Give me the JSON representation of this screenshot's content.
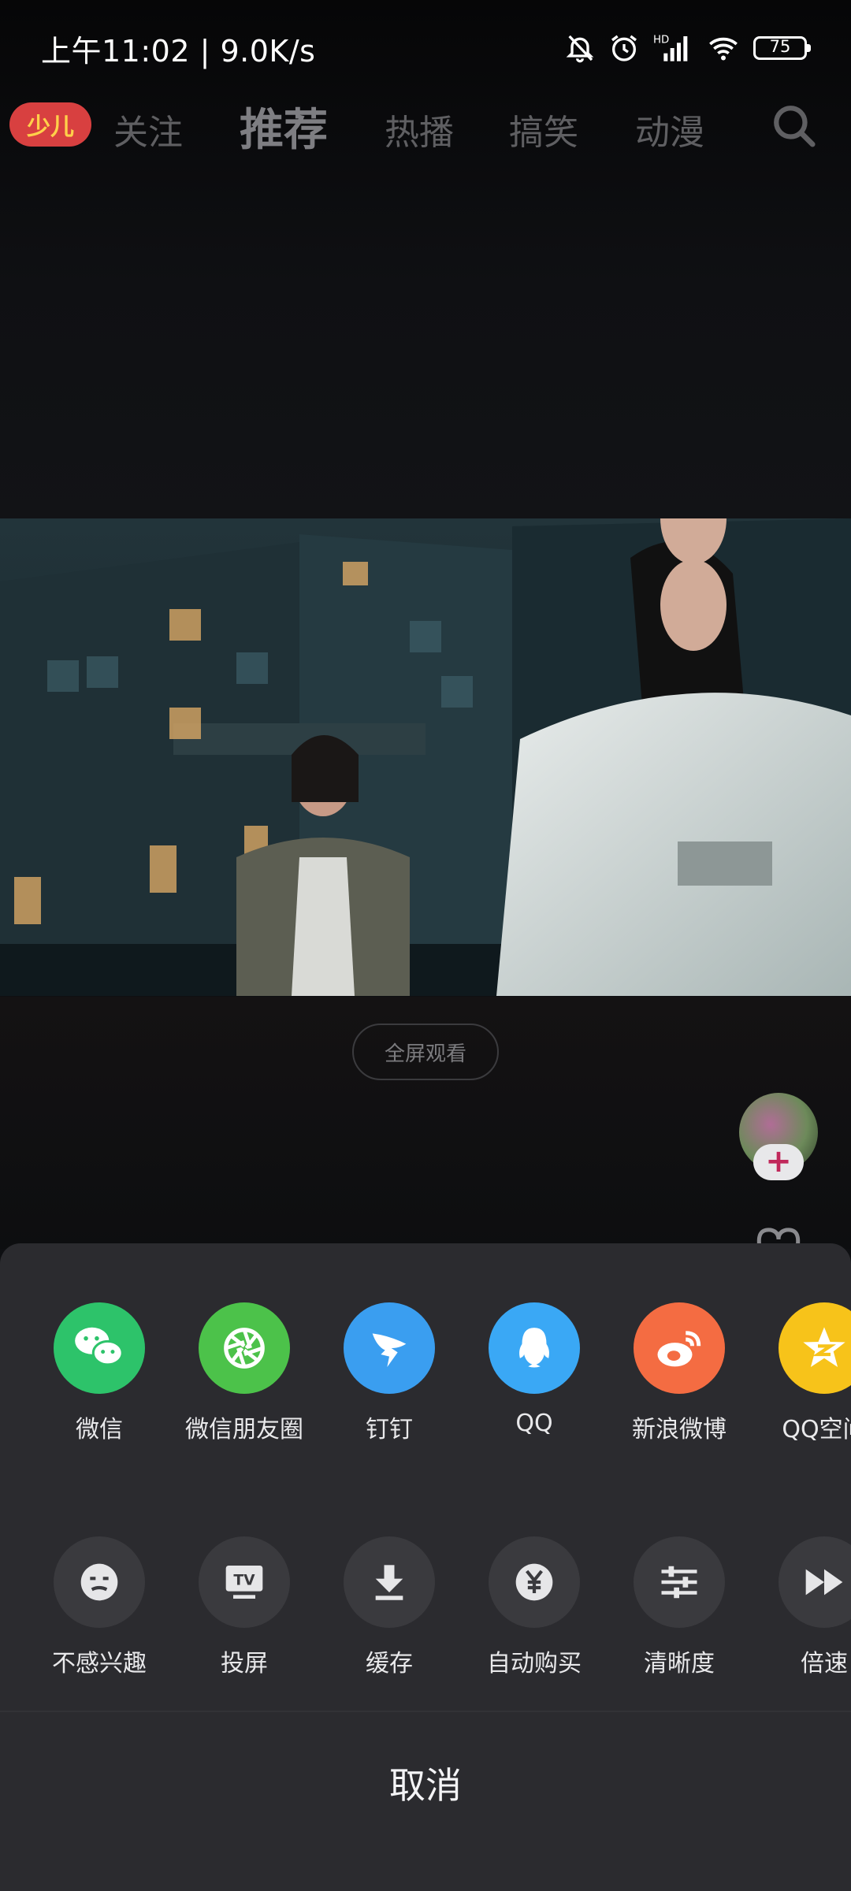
{
  "status_bar": {
    "time_speed": "上午11:02 | 9.0K/s",
    "battery": "75",
    "icons": [
      "mute-bell-icon",
      "alarm-icon",
      "hd-signal-icon",
      "wifi-icon",
      "battery-icon"
    ]
  },
  "nav": {
    "logo_text": "少儿",
    "tabs": [
      {
        "label": "关注",
        "active": false
      },
      {
        "label": "推荐",
        "active": true
      },
      {
        "label": "热播",
        "active": false
      },
      {
        "label": "搞笑",
        "active": false
      },
      {
        "label": "动漫",
        "active": false
      }
    ],
    "search_icon": "search-icon"
  },
  "video": {
    "fullscreen_label": "全屏观看"
  },
  "side": {
    "follow_plus": "+",
    "like_icon": "heart-icon"
  },
  "share_sheet": {
    "share_targets": [
      {
        "label": "微信",
        "icon": "wechat-icon",
        "color": "#2dc36a"
      },
      {
        "label": "微信朋友圈",
        "icon": "wechat-moments-icon",
        "color": "#4cc24a"
      },
      {
        "label": "钉钉",
        "icon": "dingtalk-icon",
        "color": "#3a9ef0"
      },
      {
        "label": "QQ",
        "icon": "qq-icon",
        "color": "#3aa8f5"
      },
      {
        "label": "新浪微博",
        "icon": "weibo-icon",
        "color": "#f46c42"
      },
      {
        "label": "QQ空间",
        "icon": "qzone-icon",
        "color": "#f7c31a"
      }
    ],
    "actions": [
      {
        "label": "不感兴趣",
        "icon": "not-interested-icon"
      },
      {
        "label": "投屏",
        "icon": "tv-cast-icon"
      },
      {
        "label": "缓存",
        "icon": "download-icon"
      },
      {
        "label": "自动购买",
        "icon": "yen-icon"
      },
      {
        "label": "清晰度",
        "icon": "sliders-icon"
      },
      {
        "label": "倍速",
        "icon": "fast-forward-icon"
      }
    ],
    "cancel_label": "取消"
  }
}
